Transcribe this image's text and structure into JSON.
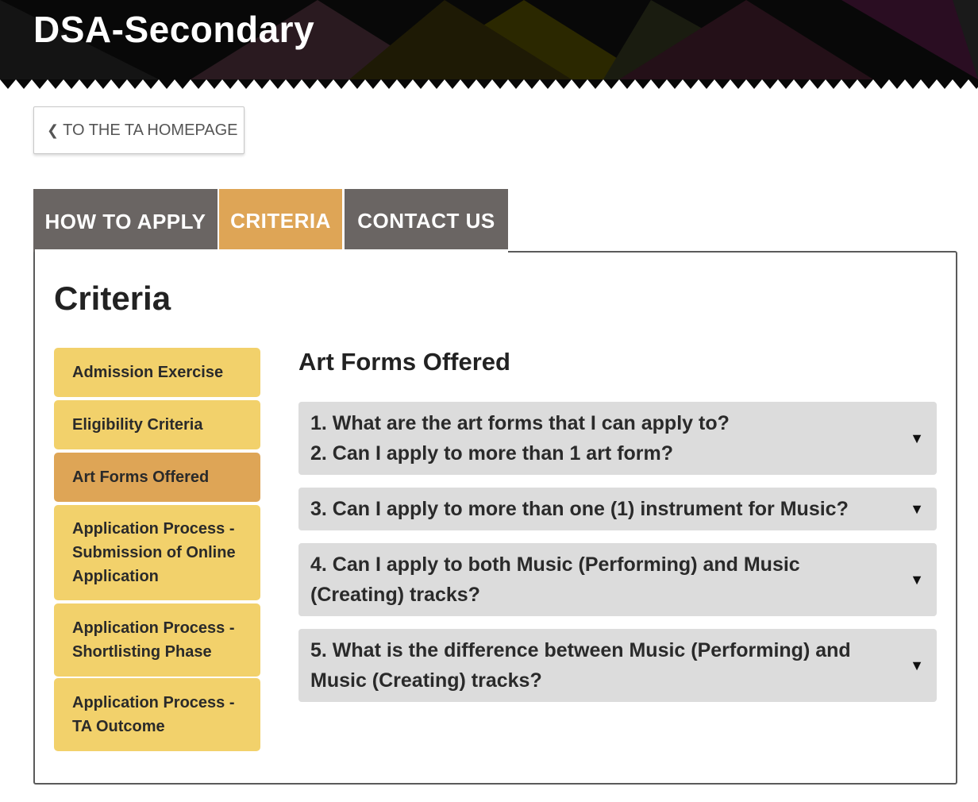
{
  "header": {
    "site_title": "DSA-Secondary"
  },
  "back_button": {
    "label": "TO THE TA HOMEPAGE",
    "icon": "chevron-left-icon"
  },
  "tabs": [
    {
      "label": "HOW TO APPLY",
      "active": false
    },
    {
      "label": "CRITERIA",
      "active": true
    },
    {
      "label": "CONTACT US",
      "active": false
    }
  ],
  "section": {
    "title": "Criteria"
  },
  "side_menu": [
    {
      "label": "Admission Exercise",
      "active": false
    },
    {
      "label": "Eligibility Criteria",
      "active": false
    },
    {
      "label": "Art Forms Offered",
      "active": true
    },
    {
      "label": "Application Process - Submission of Online Application",
      "active": false
    },
    {
      "label": "Application Process - Shortlisting Phase",
      "active": false
    },
    {
      "label": "Application Process - TA Outcome",
      "active": false
    }
  ],
  "content": {
    "heading": "Art Forms Offered",
    "faqs": [
      {
        "lines": [
          "1. What are the art forms that I can apply to?",
          "2. Can I apply to more than 1 art form?"
        ]
      },
      {
        "lines": [
          "3. Can I apply to more than one (1) instrument for Music?"
        ]
      },
      {
        "lines": [
          "4. Can I apply to both Music (Performing) and Music (Creating) tracks?"
        ]
      },
      {
        "lines": [
          "5. What is the difference between Music (Performing) and Music (Creating) tracks?"
        ]
      }
    ],
    "expand_icon": "triangle-down-icon"
  },
  "colors": {
    "tab_inactive": "#6a6563",
    "tab_active": "#dea556",
    "menu_item": "#f2d16b",
    "menu_item_active": "#dea556",
    "faq_background": "#dcdcdc"
  }
}
